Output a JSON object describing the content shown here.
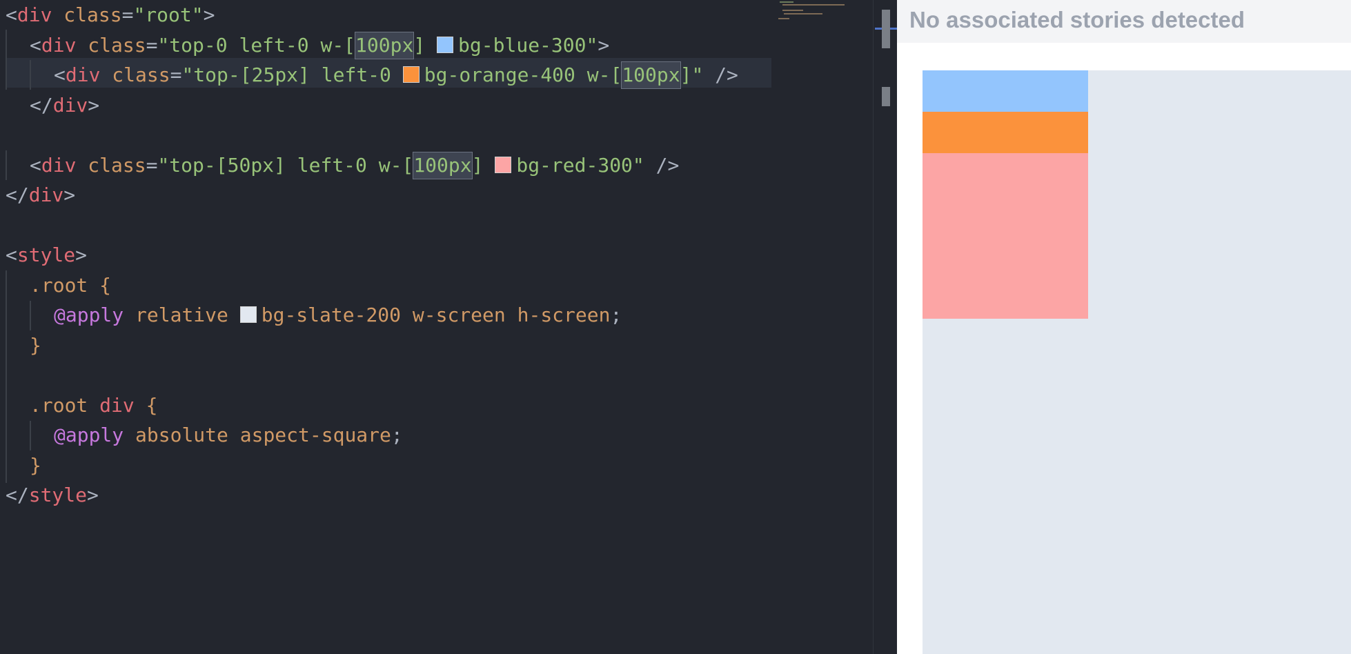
{
  "editor": {
    "lines": [
      {
        "id": "l1",
        "segments": [
          {
            "t": "<",
            "c": "punc"
          },
          {
            "t": "div",
            "c": "tag"
          },
          {
            "t": " ",
            "c": "punc"
          },
          {
            "t": "class",
            "c": "attr"
          },
          {
            "t": "=",
            "c": "punc"
          },
          {
            "t": "\"root\"",
            "c": "str"
          },
          {
            "t": ">",
            "c": "punc"
          }
        ]
      },
      {
        "id": "l2",
        "segments": [
          {
            "t": "<",
            "c": "punc"
          },
          {
            "t": "div",
            "c": "tag"
          },
          {
            "t": " ",
            "c": "punc"
          },
          {
            "t": "class",
            "c": "attr"
          },
          {
            "t": "=",
            "c": "punc"
          },
          {
            "t": "\"top-0 left-0 w-[",
            "c": "str"
          },
          {
            "t": "100px",
            "c": "str",
            "hl": true
          },
          {
            "t": "] ",
            "c": "str"
          },
          {
            "t": "",
            "c": "swatch",
            "color": "#93c5fd"
          },
          {
            "t": "bg-blue-300\"",
            "c": "str"
          },
          {
            "t": ">",
            "c": "punc"
          }
        ]
      },
      {
        "id": "l3",
        "segments": [
          {
            "t": "<",
            "c": "punc"
          },
          {
            "t": "div",
            "c": "tag"
          },
          {
            "t": " ",
            "c": "punc"
          },
          {
            "t": "class",
            "c": "attr"
          },
          {
            "t": "=",
            "c": "punc"
          },
          {
            "t": "\"top-[25px] left-0 ",
            "c": "str"
          },
          {
            "t": "",
            "c": "swatch",
            "color": "#fb923c"
          },
          {
            "t": "bg-orange-400 w-[",
            "c": "str"
          },
          {
            "t": "100px",
            "c": "str",
            "hl": true
          },
          {
            "t": "]\"",
            "c": "str"
          },
          {
            "t": " />",
            "c": "punc"
          }
        ]
      },
      {
        "id": "l4",
        "segments": [
          {
            "t": "</",
            "c": "punc"
          },
          {
            "t": "div",
            "c": "tag"
          },
          {
            "t": ">",
            "c": "punc"
          }
        ]
      },
      {
        "id": "l5",
        "segments": []
      },
      {
        "id": "l6",
        "segments": [
          {
            "t": "<",
            "c": "punc"
          },
          {
            "t": "div",
            "c": "tag"
          },
          {
            "t": " ",
            "c": "punc"
          },
          {
            "t": "class",
            "c": "attr"
          },
          {
            "t": "=",
            "c": "punc"
          },
          {
            "t": "\"top-[50px] left-0 w-[",
            "c": "str"
          },
          {
            "t": "100px",
            "c": "str",
            "hl": true
          },
          {
            "t": "] ",
            "c": "str"
          },
          {
            "t": "",
            "c": "swatch",
            "color": "#fca5a5"
          },
          {
            "t": "bg-red-300\"",
            "c": "str"
          },
          {
            "t": " />",
            "c": "punc"
          }
        ]
      },
      {
        "id": "l7",
        "segments": [
          {
            "t": "</",
            "c": "punc"
          },
          {
            "t": "div",
            "c": "tag"
          },
          {
            "t": ">",
            "c": "punc"
          }
        ]
      },
      {
        "id": "l8",
        "segments": []
      },
      {
        "id": "l9",
        "segments": [
          {
            "t": "<",
            "c": "punc"
          },
          {
            "t": "style",
            "c": "tag"
          },
          {
            "t": ">",
            "c": "punc"
          }
        ]
      },
      {
        "id": "l10",
        "segments": [
          {
            "t": ".root",
            "c": "sel"
          },
          {
            "t": " {",
            "c": "sel"
          }
        ]
      },
      {
        "id": "l11",
        "segments": [
          {
            "t": "@apply",
            "c": "kw"
          },
          {
            "t": " relative ",
            "c": "val"
          },
          {
            "t": "",
            "c": "swatch",
            "color": "#e2e8f0"
          },
          {
            "t": "bg-slate-200 w-screen h-screen",
            "c": "val"
          },
          {
            "t": ";",
            "c": "punc"
          }
        ]
      },
      {
        "id": "l12",
        "segments": [
          {
            "t": "}",
            "c": "sel"
          }
        ]
      },
      {
        "id": "l13",
        "segments": []
      },
      {
        "id": "l14",
        "segments": [
          {
            "t": ".root",
            "c": "sel"
          },
          {
            "t": " div",
            "c": "tag"
          },
          {
            "t": " {",
            "c": "sel"
          }
        ]
      },
      {
        "id": "l15",
        "segments": [
          {
            "t": "@apply",
            "c": "kw"
          },
          {
            "t": " absolute aspect-square",
            "c": "val"
          },
          {
            "t": ";",
            "c": "punc"
          }
        ]
      },
      {
        "id": "l16",
        "segments": [
          {
            "t": "}",
            "c": "sel"
          }
        ]
      },
      {
        "id": "l17",
        "segments": [
          {
            "t": "</",
            "c": "punc"
          },
          {
            "t": "style",
            "c": "tag"
          },
          {
            "t": ">",
            "c": "punc"
          }
        ]
      }
    ]
  },
  "preview": {
    "title": "No associated stories detected"
  },
  "colors": {
    "blue": "#93c5fd",
    "orange": "#fb923c",
    "red": "#fca5a5",
    "slate": "#e2e8f0"
  }
}
